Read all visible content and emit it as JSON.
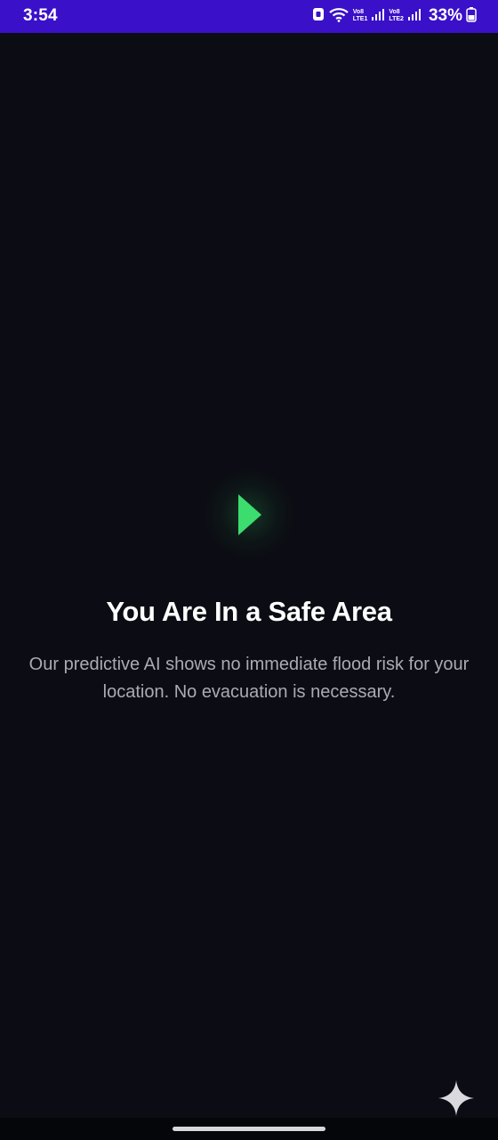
{
  "status_bar": {
    "time": "3:54",
    "network1_top": "Vo8",
    "network1_bottom": "LTE1",
    "network2_top": "Vo8",
    "network2_bottom": "LTE2",
    "battery_percent": "33%"
  },
  "main": {
    "status_icon": "green-play-arrow-icon",
    "accent_color": "#3ddc6e",
    "title": "You Are In a Safe Area",
    "message": "Our predictive AI shows no immediate flood risk for your location. No evacuation is necessary."
  },
  "overlay": {
    "assistant_icon": "sparkle-icon"
  }
}
